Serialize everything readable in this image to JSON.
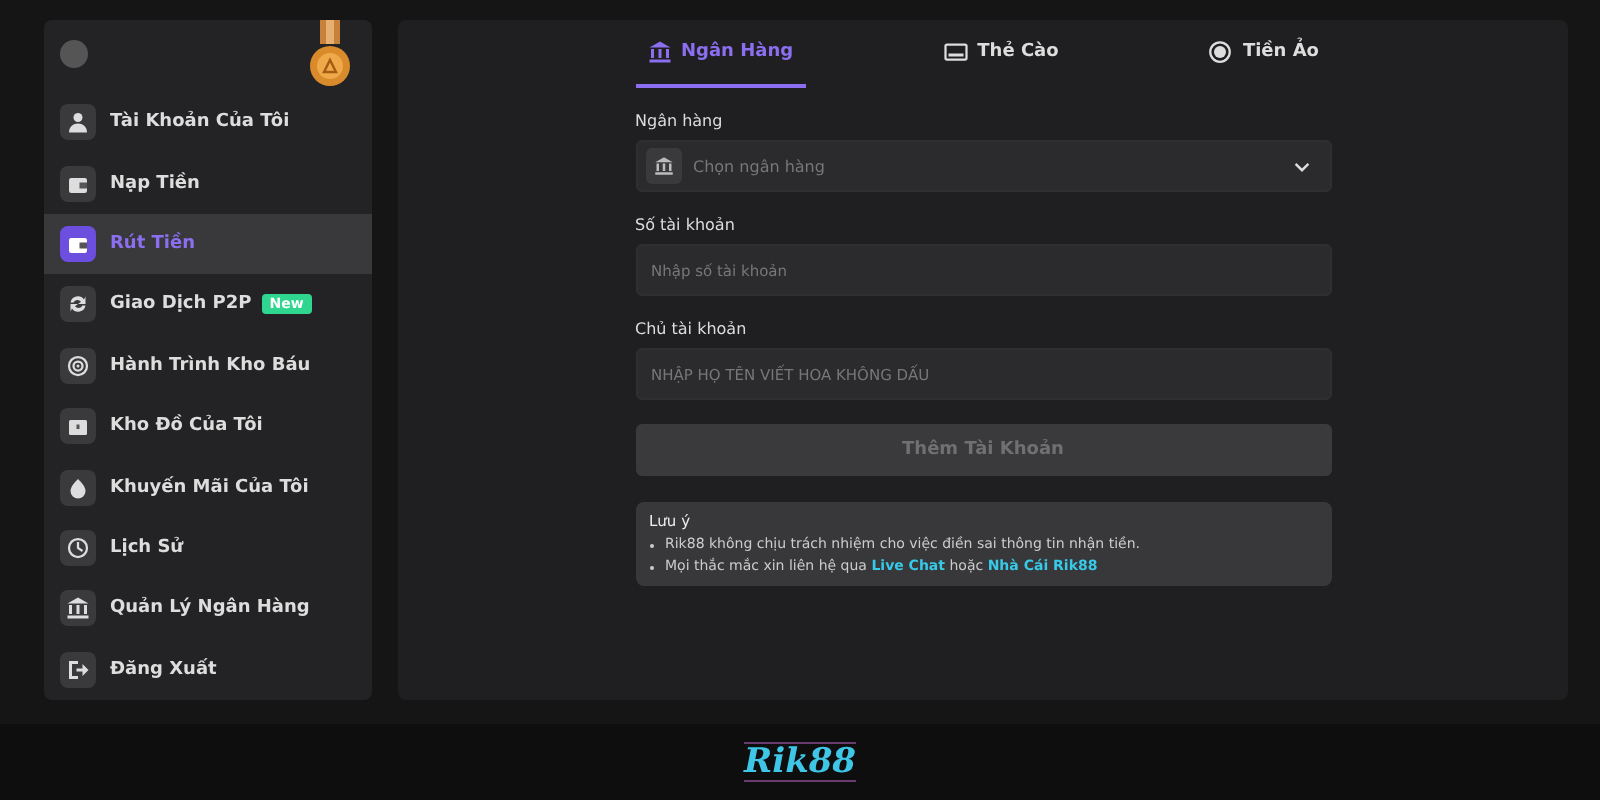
{
  "sidebar": {
    "items": [
      {
        "label": "Tài Khoản Của Tôi",
        "selected": false
      },
      {
        "label": "Nạp Tiền",
        "selected": false
      },
      {
        "label": "Rút Tiền",
        "selected": true
      },
      {
        "label": "Giao Dịch P2P",
        "selected": false,
        "badge": "New"
      },
      {
        "label": "Hành Trình Kho Báu",
        "selected": false
      },
      {
        "label": "Kho Đồ Của Tôi",
        "selected": false
      },
      {
        "label": "Khuyến Mãi Của Tôi",
        "selected": false
      },
      {
        "label": "Lịch Sử",
        "selected": false
      },
      {
        "label": "Quản Lý Ngân Hàng",
        "selected": false
      },
      {
        "label": "Đăng Xuất",
        "selected": false
      }
    ]
  },
  "tabs": [
    {
      "label": "Ngân Hàng",
      "selected": true
    },
    {
      "label": "Thẻ Cào",
      "selected": false
    },
    {
      "label": "Tiền Ảo",
      "selected": false
    }
  ],
  "form": {
    "fields": [
      {
        "label": "Ngân hàng",
        "kind": "select",
        "placeholder": "Chọn ngân hàng"
      },
      {
        "label": "Số tài khoản",
        "kind": "text",
        "placeholder": "Nhập số tài khoản"
      },
      {
        "label": "Chủ tài khoản",
        "kind": "text",
        "placeholder": "NHẬP HỌ TÊN VIẾT HOA KHÔNG DẤU"
      }
    ],
    "submit": {
      "label": "Thêm Tài Khoản",
      "disabled": true
    }
  },
  "note": {
    "title": "Lưu ý",
    "items": [
      {
        "text": "Rik88 không chịu trách nhiệm cho việc điền sai thông tin nhận tiền."
      },
      {
        "text": "Mọi thắc mắc xin liên hệ qua",
        "links": [
          "Live Chat",
          "Nhà Cái Rik88"
        ],
        "joiner": "hoặc"
      }
    ]
  },
  "footer": {
    "logo": "Rik88"
  }
}
